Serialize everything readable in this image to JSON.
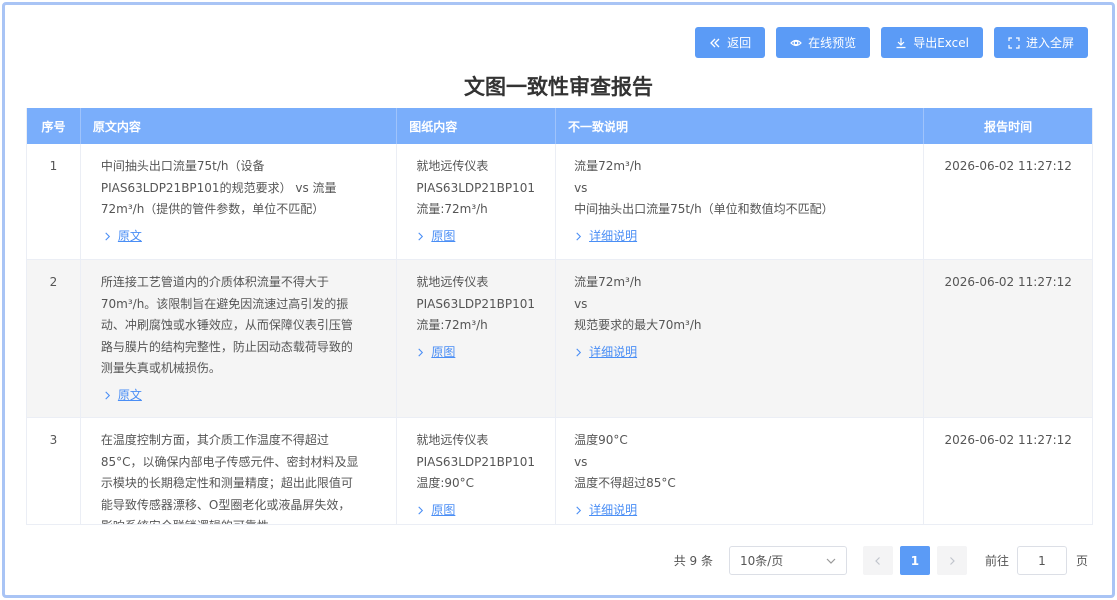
{
  "toolbar": {
    "back_label": "返回",
    "preview_label": "在线预览",
    "export_label": "导出Excel",
    "fullscreen_label": "进入全屏"
  },
  "report_title": "文图一致性审查报告",
  "table": {
    "headers": [
      "序号",
      "原文内容",
      "图纸内容",
      "不一致说明",
      "报告时间"
    ],
    "rows": [
      {
        "index": "1",
        "original_lines": [
          "中间抽头出口流量75t/h（设备",
          "PIAS63LDP21BP101的规范要求） vs 流量",
          "72m³/h（提供的管件参数，单位不匹配）"
        ],
        "original_link": "原文",
        "drawing_lines": [
          "就地远传仪表",
          "PIAS63LDP21BP101",
          "流量:72m³/h"
        ],
        "drawing_link": "原图",
        "diff_lines": [
          "流量72m³/h",
          "vs",
          "中间抽头出口流量75t/h（单位和数值均不匹配）"
        ],
        "diff_link": "详细说明",
        "time": "2026-06-02 11:27:12"
      },
      {
        "index": "2",
        "original_lines": [
          "所连接工艺管道内的介质体积流量不得大于",
          "70m³/h。该限制旨在避免因流速过高引发的振",
          "动、冲刷腐蚀或水锤效应，从而保障仪表引压管",
          "路与膜片的结构完整性，防止因动态载荷导致的",
          "测量失真或机械损伤。"
        ],
        "original_link": "原文",
        "drawing_lines": [
          "就地远传仪表",
          "PIAS63LDP21BP101",
          "流量:72m³/h"
        ],
        "drawing_link": "原图",
        "diff_lines": [
          "流量72m³/h",
          "vs",
          "规范要求的最大70m³/h"
        ],
        "diff_link": "详细说明",
        "time": "2026-06-02 11:27:12"
      },
      {
        "index": "3",
        "original_lines": [
          "在温度控制方面，其介质工作温度不得超过",
          "85°C，以确保内部电子传感元件、密封材料及显",
          "示模块的长期稳定性和测量精度；超出此限值可",
          "能导致传感器漂移、O型圈老化或液晶屏失效，",
          "影响系统安全联锁逻辑的可靠性。"
        ],
        "original_link": "原文",
        "drawing_lines": [
          "就地远传仪表",
          "PIAS63LDP21BP101",
          "温度:90°C"
        ],
        "drawing_link": "原图",
        "diff_lines": [
          "温度90°C",
          "vs",
          "温度不得超过85°C"
        ],
        "diff_link": "详细说明",
        "time": "2026-06-02 11:27:12"
      }
    ]
  },
  "pagination": {
    "total_text": "共 9 条",
    "page_size": "10条/页",
    "current_page": "1",
    "jump_label": "前往",
    "jump_value": "1",
    "jump_suffix": "页"
  },
  "colors": {
    "accent": "#5b9bf6",
    "header_bg": "#7aaefb",
    "link": "#4a8ef5",
    "frame": "#a9c4f5"
  }
}
